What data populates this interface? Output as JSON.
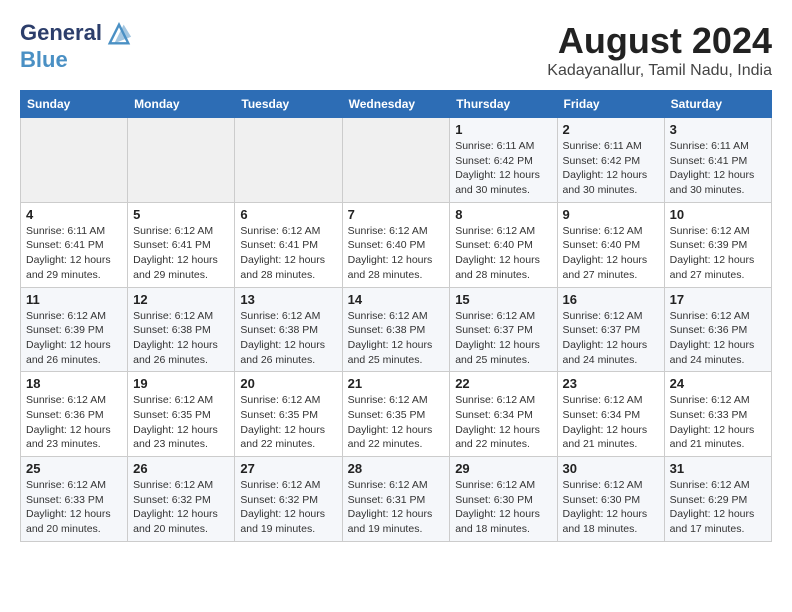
{
  "header": {
    "logo_line1": "General",
    "logo_line2": "Blue",
    "month_year": "August 2024",
    "location": "Kadayanallur, Tamil Nadu, India"
  },
  "days_of_week": [
    "Sunday",
    "Monday",
    "Tuesday",
    "Wednesday",
    "Thursday",
    "Friday",
    "Saturday"
  ],
  "weeks": [
    [
      {
        "day": "",
        "info": ""
      },
      {
        "day": "",
        "info": ""
      },
      {
        "day": "",
        "info": ""
      },
      {
        "day": "",
        "info": ""
      },
      {
        "day": "1",
        "info": "Sunrise: 6:11 AM\nSunset: 6:42 PM\nDaylight: 12 hours\nand 30 minutes."
      },
      {
        "day": "2",
        "info": "Sunrise: 6:11 AM\nSunset: 6:42 PM\nDaylight: 12 hours\nand 30 minutes."
      },
      {
        "day": "3",
        "info": "Sunrise: 6:11 AM\nSunset: 6:41 PM\nDaylight: 12 hours\nand 30 minutes."
      }
    ],
    [
      {
        "day": "4",
        "info": "Sunrise: 6:11 AM\nSunset: 6:41 PM\nDaylight: 12 hours\nand 29 minutes."
      },
      {
        "day": "5",
        "info": "Sunrise: 6:12 AM\nSunset: 6:41 PM\nDaylight: 12 hours\nand 29 minutes."
      },
      {
        "day": "6",
        "info": "Sunrise: 6:12 AM\nSunset: 6:41 PM\nDaylight: 12 hours\nand 28 minutes."
      },
      {
        "day": "7",
        "info": "Sunrise: 6:12 AM\nSunset: 6:40 PM\nDaylight: 12 hours\nand 28 minutes."
      },
      {
        "day": "8",
        "info": "Sunrise: 6:12 AM\nSunset: 6:40 PM\nDaylight: 12 hours\nand 28 minutes."
      },
      {
        "day": "9",
        "info": "Sunrise: 6:12 AM\nSunset: 6:40 PM\nDaylight: 12 hours\nand 27 minutes."
      },
      {
        "day": "10",
        "info": "Sunrise: 6:12 AM\nSunset: 6:39 PM\nDaylight: 12 hours\nand 27 minutes."
      }
    ],
    [
      {
        "day": "11",
        "info": "Sunrise: 6:12 AM\nSunset: 6:39 PM\nDaylight: 12 hours\nand 26 minutes."
      },
      {
        "day": "12",
        "info": "Sunrise: 6:12 AM\nSunset: 6:38 PM\nDaylight: 12 hours\nand 26 minutes."
      },
      {
        "day": "13",
        "info": "Sunrise: 6:12 AM\nSunset: 6:38 PM\nDaylight: 12 hours\nand 26 minutes."
      },
      {
        "day": "14",
        "info": "Sunrise: 6:12 AM\nSunset: 6:38 PM\nDaylight: 12 hours\nand 25 minutes."
      },
      {
        "day": "15",
        "info": "Sunrise: 6:12 AM\nSunset: 6:37 PM\nDaylight: 12 hours\nand 25 minutes."
      },
      {
        "day": "16",
        "info": "Sunrise: 6:12 AM\nSunset: 6:37 PM\nDaylight: 12 hours\nand 24 minutes."
      },
      {
        "day": "17",
        "info": "Sunrise: 6:12 AM\nSunset: 6:36 PM\nDaylight: 12 hours\nand 24 minutes."
      }
    ],
    [
      {
        "day": "18",
        "info": "Sunrise: 6:12 AM\nSunset: 6:36 PM\nDaylight: 12 hours\nand 23 minutes."
      },
      {
        "day": "19",
        "info": "Sunrise: 6:12 AM\nSunset: 6:35 PM\nDaylight: 12 hours\nand 23 minutes."
      },
      {
        "day": "20",
        "info": "Sunrise: 6:12 AM\nSunset: 6:35 PM\nDaylight: 12 hours\nand 22 minutes."
      },
      {
        "day": "21",
        "info": "Sunrise: 6:12 AM\nSunset: 6:35 PM\nDaylight: 12 hours\nand 22 minutes."
      },
      {
        "day": "22",
        "info": "Sunrise: 6:12 AM\nSunset: 6:34 PM\nDaylight: 12 hours\nand 22 minutes."
      },
      {
        "day": "23",
        "info": "Sunrise: 6:12 AM\nSunset: 6:34 PM\nDaylight: 12 hours\nand 21 minutes."
      },
      {
        "day": "24",
        "info": "Sunrise: 6:12 AM\nSunset: 6:33 PM\nDaylight: 12 hours\nand 21 minutes."
      }
    ],
    [
      {
        "day": "25",
        "info": "Sunrise: 6:12 AM\nSunset: 6:33 PM\nDaylight: 12 hours\nand 20 minutes."
      },
      {
        "day": "26",
        "info": "Sunrise: 6:12 AM\nSunset: 6:32 PM\nDaylight: 12 hours\nand 20 minutes."
      },
      {
        "day": "27",
        "info": "Sunrise: 6:12 AM\nSunset: 6:32 PM\nDaylight: 12 hours\nand 19 minutes."
      },
      {
        "day": "28",
        "info": "Sunrise: 6:12 AM\nSunset: 6:31 PM\nDaylight: 12 hours\nand 19 minutes."
      },
      {
        "day": "29",
        "info": "Sunrise: 6:12 AM\nSunset: 6:30 PM\nDaylight: 12 hours\nand 18 minutes."
      },
      {
        "day": "30",
        "info": "Sunrise: 6:12 AM\nSunset: 6:30 PM\nDaylight: 12 hours\nand 18 minutes."
      },
      {
        "day": "31",
        "info": "Sunrise: 6:12 AM\nSunset: 6:29 PM\nDaylight: 12 hours\nand 17 minutes."
      }
    ]
  ]
}
